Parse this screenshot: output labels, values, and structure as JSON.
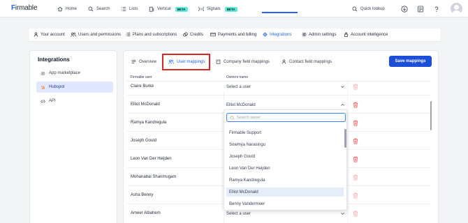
{
  "topnav": {
    "logo": "Firmable",
    "items": [
      {
        "label": "Home",
        "icon": "home-icon"
      },
      {
        "label": "Search",
        "icon": "search-icon"
      },
      {
        "label": "Lists",
        "icon": "list-icon"
      },
      {
        "label": "Vertical",
        "icon": "building-icon",
        "badge": "BETA"
      },
      {
        "label": "Signals",
        "icon": "signal-icon",
        "badge": "BETA"
      }
    ],
    "quick_lookup": "Quick lookup"
  },
  "settings_tabs": [
    {
      "label": "Your account",
      "icon": "user-icon"
    },
    {
      "label": "Users and permissions",
      "icon": "users-icon"
    },
    {
      "label": "Plans and subscriptions",
      "icon": "list-icon"
    },
    {
      "label": "Credits",
      "icon": "credits-icon"
    },
    {
      "label": "Payments and billing",
      "icon": "card-icon"
    },
    {
      "label": "Integrations",
      "icon": "integrations-icon",
      "active": true
    },
    {
      "label": "Admin settings",
      "icon": "gear-icon"
    },
    {
      "label": "Account intelligence",
      "icon": "lock-icon"
    }
  ],
  "left_panel": {
    "title": "Integrations",
    "items": [
      {
        "label": "App marketplace",
        "icon": "marketplace-icon"
      },
      {
        "label": "Hubspot",
        "icon": "hubspot-icon",
        "active": true
      },
      {
        "label": "API",
        "icon": "code-icon"
      }
    ]
  },
  "main": {
    "tabs": [
      {
        "label": "Overview",
        "icon": "overview-icon"
      },
      {
        "label": "User mappings",
        "icon": "users-icon",
        "active": true
      },
      {
        "label": "Company field mappings",
        "icon": "building-icon"
      },
      {
        "label": "Contact field mappings",
        "icon": "contact-icon"
      }
    ],
    "save_label": "Save mappings",
    "col_user": "Firmable user",
    "col_owner": "Owners name",
    "rows": [
      {
        "user": "Claire Burke",
        "owner": "Select a user"
      },
      {
        "user": "Elliot McDonald",
        "owner": "Elliot McDonald"
      },
      {
        "user": "Ramya Kandregula",
        "owner": ""
      },
      {
        "user": "Joseph Gould",
        "owner": ""
      },
      {
        "user": "Leon Van Der Heijden",
        "owner": ""
      },
      {
        "user": "Mohanabai Shanmugam",
        "owner": ""
      },
      {
        "user": "Asha Benny",
        "owner": ""
      },
      {
        "user": "Ameer Albahem",
        "owner": "Select a user"
      }
    ],
    "dropdown": {
      "search_placeholder": "Search owner",
      "options": [
        "Firmable Support",
        "Sowmya Narasingu",
        "Joseph Gould",
        "Leon Van Der Heijden",
        "Ramya Kandregula",
        "Elliot McDonald",
        "Benny Vandermeer"
      ],
      "selected": "Elliot McDonald"
    }
  },
  "colors": {
    "accent": "#2563eb",
    "highlight": "#dc2626",
    "delete": "#ef4444"
  }
}
